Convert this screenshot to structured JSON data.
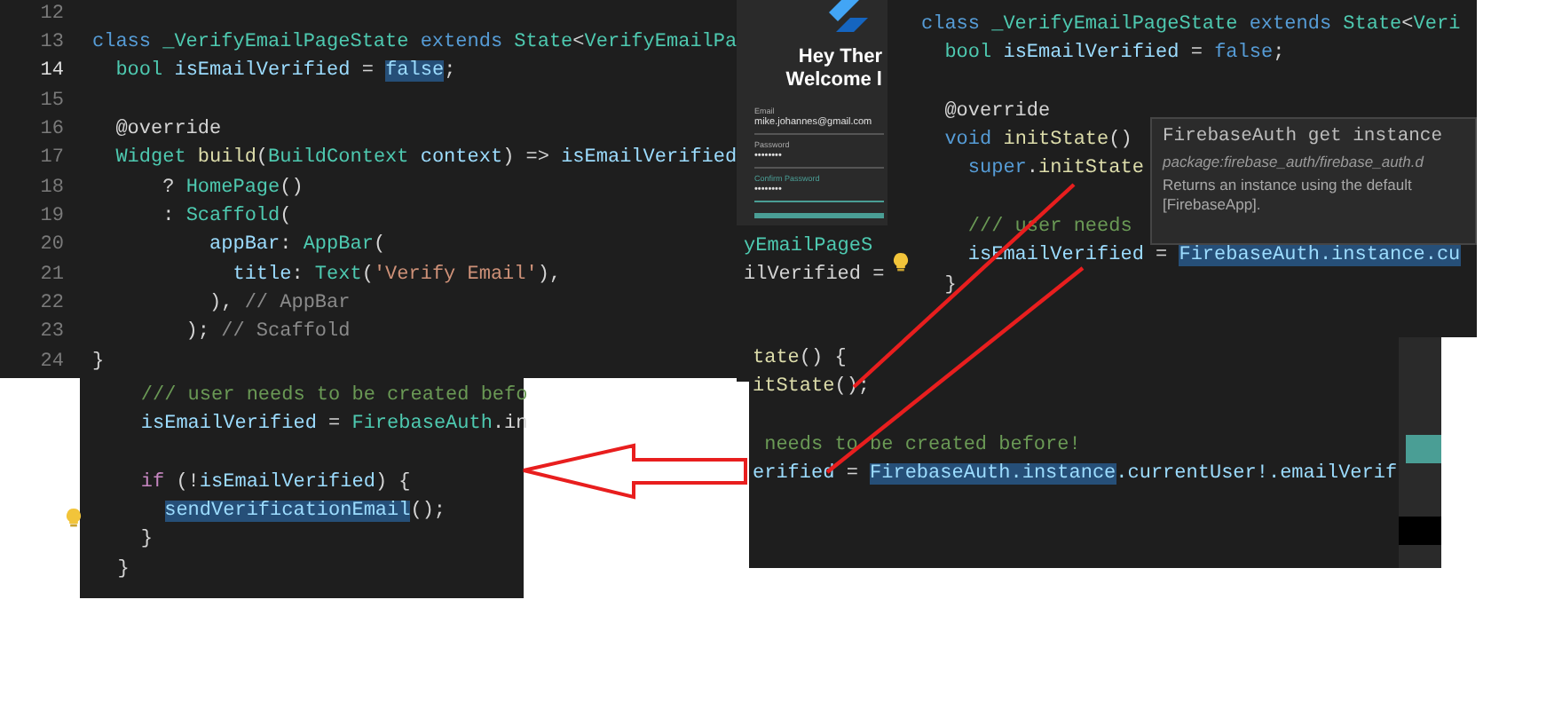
{
  "editors": [
    {
      "lines": [
        {
          "number": "12",
          "active": false
        },
        {
          "number": "13",
          "active": false,
          "segments": [
            {
              "text": "class ",
              "kind": "kw"
            },
            {
              "text": "_VerifyEmailPageState",
              "kind": "type"
            },
            {
              "text": " extends ",
              "kind": "kw"
            },
            {
              "text": "State",
              "kind": "type"
            },
            {
              "text": "<",
              "kind": "plain"
            },
            {
              "text": "VerifyEmailPa",
              "kind": "type"
            }
          ]
        },
        {
          "number": "14",
          "active": true,
          "segments": [
            {
              "text": "  bool ",
              "kind": "type"
            },
            {
              "text": "isEmailVerified",
              "kind": "var"
            },
            {
              "text": " = ",
              "kind": "plain"
            },
            {
              "text": "false",
              "kind": "sel"
            },
            {
              "text": ";",
              "kind": "plain"
            }
          ]
        },
        {
          "number": "15",
          "active": false
        },
        {
          "number": "16",
          "active": false,
          "segments": [
            {
              "text": "  @override",
              "kind": "plain"
            }
          ]
        },
        {
          "number": "17",
          "active": false,
          "segments": [
            {
              "text": "  Widget",
              "kind": "type"
            },
            {
              "text": " build",
              "kind": "fn"
            },
            {
              "text": "(",
              "kind": "plain"
            },
            {
              "text": "BuildContext",
              "kind": "type"
            },
            {
              "text": " context",
              "kind": "var"
            },
            {
              "text": ") => ",
              "kind": "plain"
            },
            {
              "text": "isEmailVerified",
              "kind": "var"
            }
          ]
        },
        {
          "number": "18",
          "active": false,
          "segments": [
            {
              "text": "      ? ",
              "kind": "plain"
            },
            {
              "text": "HomePage",
              "kind": "type"
            },
            {
              "text": "()",
              "kind": "plain"
            }
          ]
        },
        {
          "number": "19",
          "active": false,
          "segments": [
            {
              "text": "      : ",
              "kind": "plain"
            },
            {
              "text": "Scaffold",
              "kind": "type"
            },
            {
              "text": "(",
              "kind": "plain"
            }
          ]
        },
        {
          "number": "20",
          "active": false,
          "segments": [
            {
              "text": "          appBar",
              "kind": "var"
            },
            {
              "text": ": ",
              "kind": "plain"
            },
            {
              "text": "AppBar",
              "kind": "type"
            },
            {
              "text": "(",
              "kind": "plain"
            }
          ]
        },
        {
          "number": "21",
          "active": false,
          "segments": [
            {
              "text": "            title",
              "kind": "var"
            },
            {
              "text": ": ",
              "kind": "plain"
            },
            {
              "text": "Text",
              "kind": "type"
            },
            {
              "text": "(",
              "kind": "plain"
            },
            {
              "text": "'Verify Email'",
              "kind": "str"
            },
            {
              "text": "),",
              "kind": "plain"
            }
          ]
        },
        {
          "number": "22",
          "active": false,
          "segments": [
            {
              "text": "          ), ",
              "kind": "plain"
            },
            {
              "text": "// AppBar",
              "kind": "hint"
            }
          ]
        },
        {
          "number": "23",
          "active": false,
          "segments": [
            {
              "text": "        ); ",
              "kind": "plain"
            },
            {
              "text": "// Scaffold",
              "kind": "hint"
            }
          ]
        },
        {
          "number": "24",
          "active": false,
          "segments": [
            {
              "text": "}",
              "kind": "plain"
            }
          ]
        }
      ]
    },
    {
      "lines": [
        {
          "lightbulb": false,
          "segments": [
            {
              "text": "class ",
              "kind": "kw"
            },
            {
              "text": "_VerifyEmailPageState",
              "kind": "type"
            },
            {
              "text": " extends ",
              "kind": "kw"
            },
            {
              "text": "State",
              "kind": "type"
            },
            {
              "text": "<",
              "kind": "plain"
            },
            {
              "text": "Veri",
              "kind": "type"
            }
          ]
        },
        {
          "lightbulb": false,
          "segments": [
            {
              "text": "  bool ",
              "kind": "type"
            },
            {
              "text": "isEmailVerified",
              "kind": "var"
            },
            {
              "text": " = ",
              "kind": "plain"
            },
            {
              "text": "false",
              "kind": "kw"
            },
            {
              "text": ";",
              "kind": "plain"
            }
          ]
        },
        {
          "lightbulb": false
        },
        {
          "lightbulb": false,
          "segments": [
            {
              "text": "  @override",
              "kind": "plain"
            }
          ]
        },
        {
          "lightbulb": false,
          "segments": [
            {
              "text": "  void ",
              "kind": "kw"
            },
            {
              "text": "initState",
              "kind": "fn"
            },
            {
              "text": "()",
              "kind": "plain"
            }
          ]
        },
        {
          "lightbulb": false,
          "segments": [
            {
              "text": "    super",
              "kind": "kw"
            },
            {
              "text": ".",
              "kind": "plain"
            },
            {
              "text": "initState",
              "kind": "fn"
            }
          ]
        },
        {
          "lightbulb": false
        },
        {
          "lightbulb": false,
          "segments": [
            {
              "text": "    /// user needs",
              "kind": "com"
            }
          ]
        },
        {
          "lightbulb": true,
          "segments": [
            {
              "text": "    isEmailVerified",
              "kind": "var"
            },
            {
              "text": " = ",
              "kind": "plain"
            },
            {
              "text": "FirebaseAuth.instance.cu",
              "kind": "sel"
            }
          ]
        },
        {
          "lightbulb": false,
          "segments": [
            {
              "text": "  }",
              "kind": "plain"
            }
          ]
        }
      ],
      "tooltip": {
        "title": "FirebaseAuth get instance",
        "path": "package:firebase_auth/firebase_auth.d",
        "description": "Returns an instance using the default [FirebaseApp]."
      }
    },
    {
      "lines": [
        {
          "lightbulb": false,
          "segments": [
            {
              "text": "    /// user needs to be created befo",
              "kind": "com"
            }
          ]
        },
        {
          "lightbulb": false,
          "segments": [
            {
              "text": "    isEmailVerified",
              "kind": "var"
            },
            {
              "text": " = ",
              "kind": "plain"
            },
            {
              "text": "FirebaseAuth",
              "kind": "type"
            },
            {
              "text": ".in",
              "kind": "plain"
            }
          ]
        },
        {
          "lightbulb": false
        },
        {
          "lightbulb": false,
          "segments": [
            {
              "text": "    if",
              "kind": "ctl"
            },
            {
              "text": " (!",
              "kind": "plain"
            },
            {
              "text": "isEmailVerified",
              "kind": "var"
            },
            {
              "text": ") {",
              "kind": "plain"
            }
          ]
        },
        {
          "lightbulb": true,
          "segments": [
            {
              "text": "      sendVerificationEmail",
              "kind": "sel"
            },
            {
              "text": "();",
              "kind": "plain"
            }
          ]
        },
        {
          "lightbulb": false,
          "segments": [
            {
              "text": "    }",
              "kind": "plain"
            }
          ]
        },
        {
          "lightbulb": false,
          "segments": [
            {
              "text": "  }",
              "kind": "plain"
            }
          ]
        }
      ]
    },
    {
      "lines": [
        {
          "lightbulb": false,
          "segments": [
            {
              "text": "tate",
              "kind": "fn"
            },
            {
              "text": "() {",
              "kind": "plain"
            }
          ]
        },
        {
          "lightbulb": false,
          "segments": [
            {
              "text": "itState",
              "kind": "fn"
            },
            {
              "text": "();",
              "kind": "plain"
            }
          ]
        },
        {
          "lightbulb": false
        },
        {
          "lightbulb": false,
          "segments": [
            {
              "text": " needs to be created before!",
              "kind": "com"
            }
          ]
        },
        {
          "lightbulb": false,
          "segments": [
            {
              "text": "erified",
              "kind": "var"
            },
            {
              "text": " = ",
              "kind": "plain"
            },
            {
              "text": "FirebaseAuth.instance",
              "kind": "sel"
            },
            {
              "text": ".currentUser!.emailVerif",
              "kind": "var"
            }
          ]
        }
      ]
    }
  ],
  "phone_screen": {
    "heading_lines": [
      "Hey Ther",
      "Welcome l"
    ],
    "fields": [
      {
        "label": "Email",
        "value": "mike.johannes@gmail.com",
        "focused": false
      },
      {
        "label": "Password",
        "value": "••••••••",
        "focused": false
      },
      {
        "label": "Confirm Password",
        "value": "••••••••",
        "focused": true
      }
    ],
    "code_lines": [
      {
        "text": "yEmailPageS",
        "kind": "type"
      },
      {
        "text": "ilVerified =",
        "kind": "plain"
      }
    ]
  }
}
